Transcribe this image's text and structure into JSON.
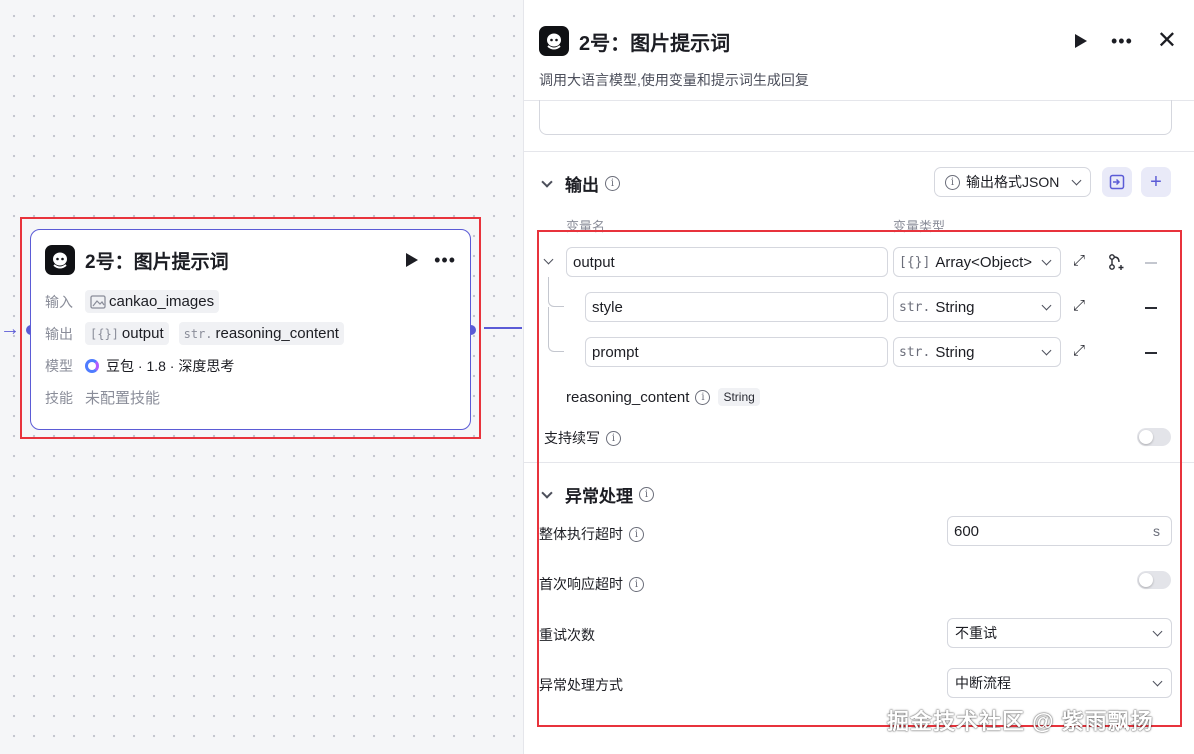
{
  "node": {
    "title": "2号：图片提示词",
    "input_label": "输入",
    "input_var": "cankao_images",
    "output_label": "输出",
    "output_vars": [
      {
        "type": "[{}]",
        "name": "output"
      },
      {
        "type": "str.",
        "name": "reasoning_content"
      }
    ],
    "model_label": "模型",
    "model_value": "豆包 · 1.8 · 深度思考",
    "skill_label": "技能",
    "skill_value": "未配置技能"
  },
  "panel": {
    "title": "2号：图片提示词",
    "description": "调用大语言模型,使用变量和提示词生成回复",
    "output_section": {
      "title": "输出",
      "format_button": "输出格式JSON",
      "col_name": "变量名",
      "col_type": "变量类型",
      "fields": [
        {
          "name": "output",
          "type_prefix": "[{}]",
          "type": "Array<Object>"
        },
        {
          "name": "style",
          "type_prefix": "str.",
          "type": "String"
        },
        {
          "name": "prompt",
          "type_prefix": "str.",
          "type": "String"
        }
      ],
      "reasoning_name": "reasoning_content",
      "reasoning_type": "String",
      "continue_label": "支持续写"
    },
    "error_section": {
      "title": "异常处理",
      "timeout_label": "整体执行超时",
      "timeout_value": "600",
      "timeout_unit": "s",
      "first_response_label": "首次响应超时",
      "retry_label": "重试次数",
      "retry_value": "不重试",
      "handling_label": "异常处理方式",
      "handling_value": "中断流程"
    }
  },
  "watermark": "掘金技术社区 @ 紫雨飘扬",
  "colors": {
    "accent": "#5b5bd6",
    "highlight": "#e8333c"
  }
}
